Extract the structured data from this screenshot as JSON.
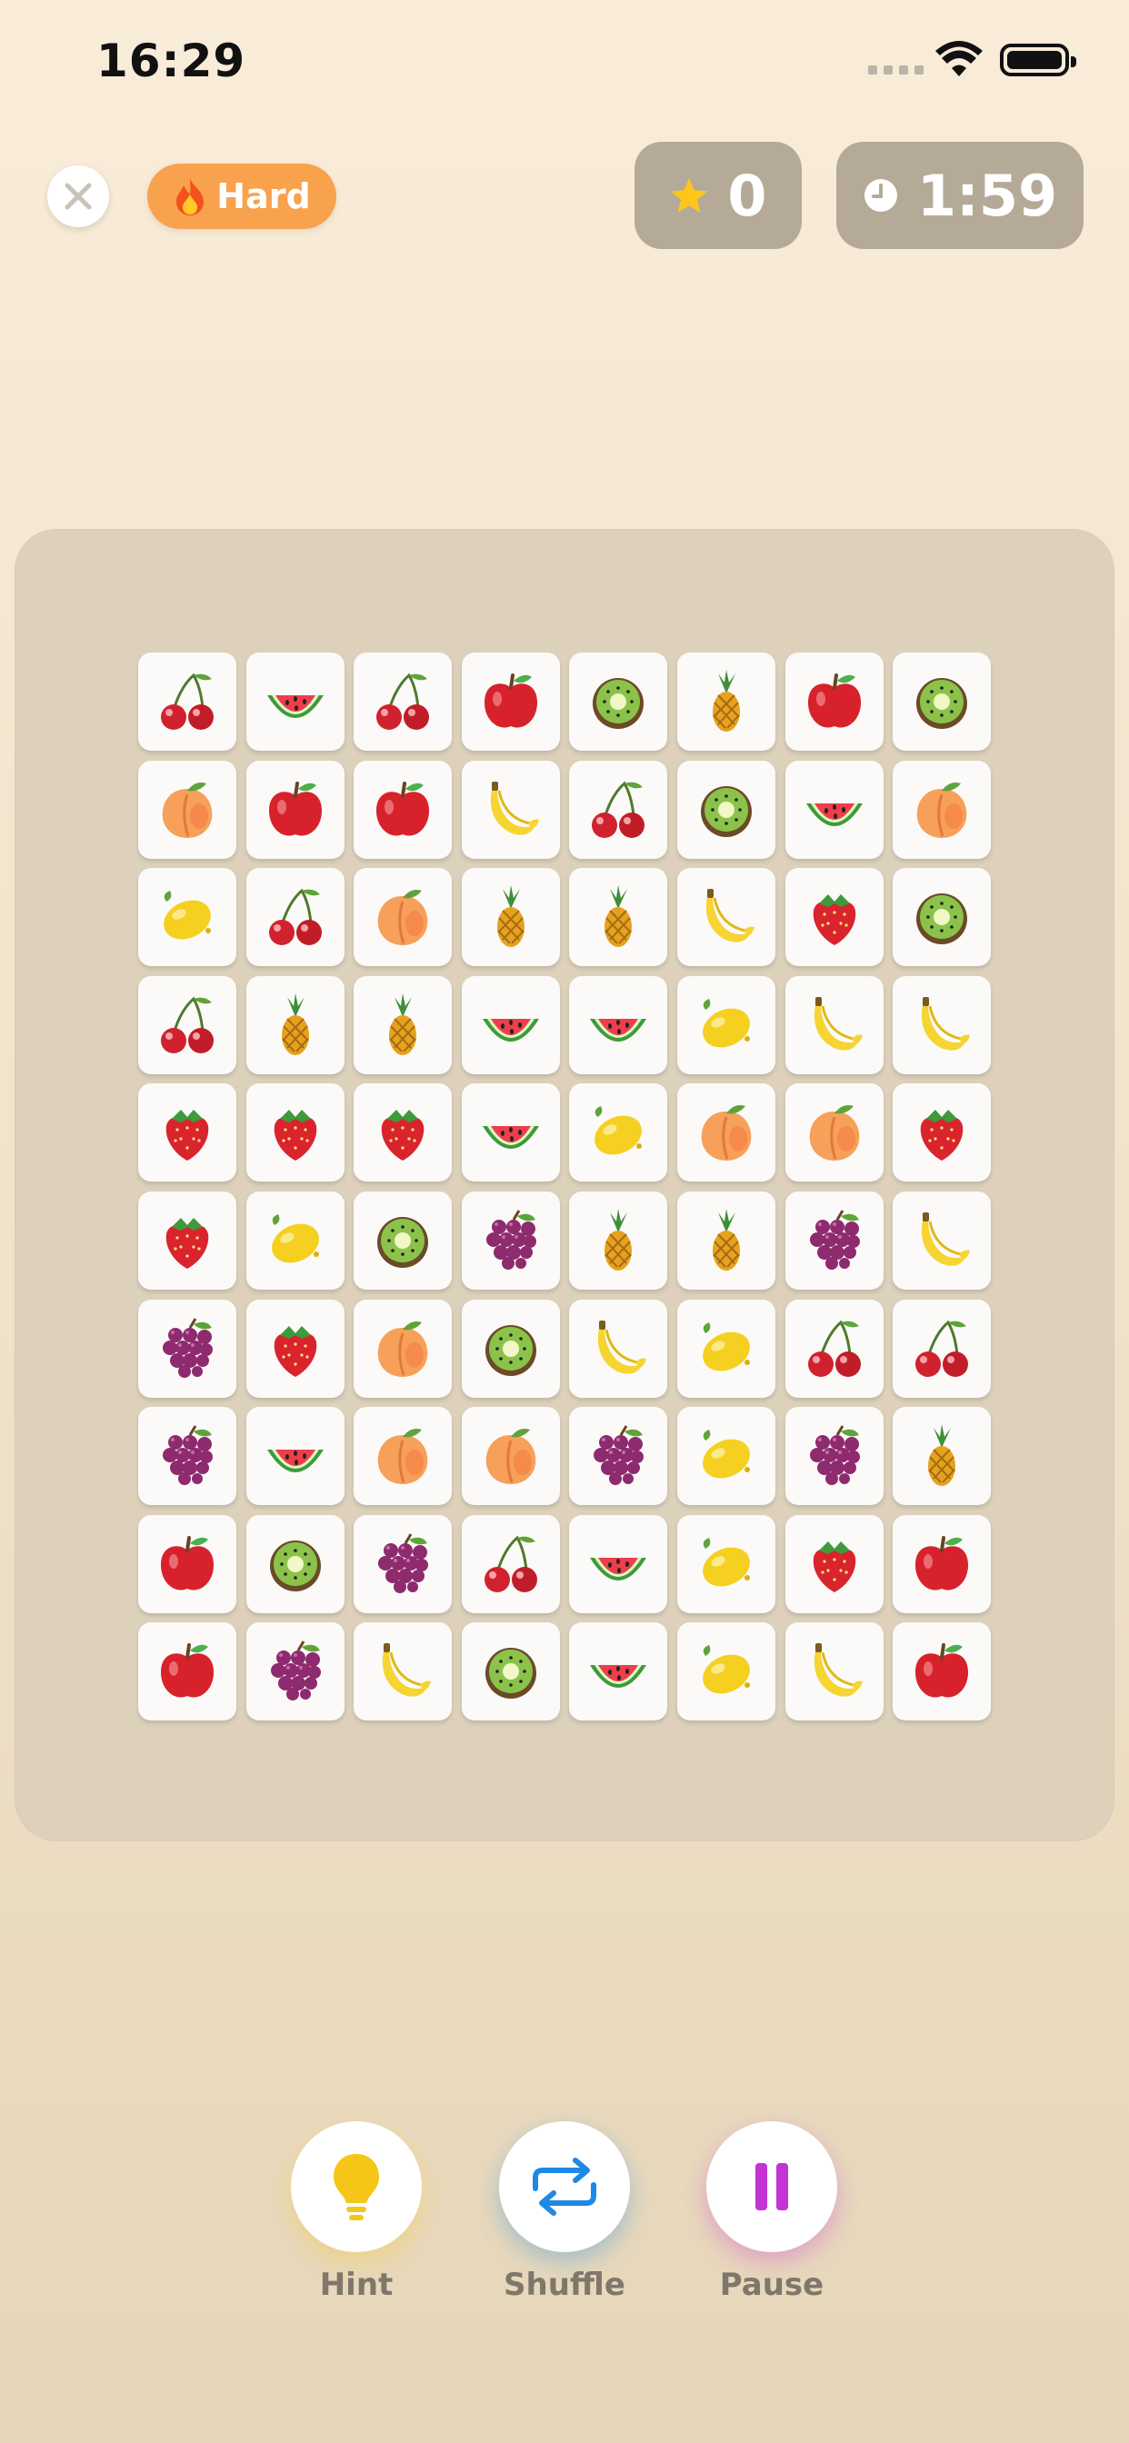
{
  "status_bar": {
    "time": "16:29"
  },
  "header": {
    "difficulty_label": "Hard",
    "difficulty_icon": "flame-icon",
    "score": "0",
    "score_icon": "star-icon",
    "timer": "1:59",
    "timer_icon": "clock-icon"
  },
  "colors": {
    "accent_orange": "#F8A24E",
    "pill_bg": "#B5AA97",
    "hint": "#F5C518",
    "shuffle": "#1E88E5",
    "pause": "#C433D6"
  },
  "board": {
    "rows": [
      [
        "cherry",
        "watermelon",
        "cherry",
        "apple",
        "kiwi",
        "pineapple",
        "apple",
        "kiwi"
      ],
      [
        "peach",
        "apple",
        "apple",
        "banana",
        "cherry",
        "kiwi",
        "watermelon",
        "peach"
      ],
      [
        "lemon",
        "cherry",
        "peach",
        "pineapple",
        "pineapple",
        "banana",
        "strawberry",
        "kiwi"
      ],
      [
        "cherry",
        "pineapple",
        "pineapple",
        "watermelon",
        "watermelon",
        "lemon",
        "banana",
        "banana"
      ],
      [
        "strawberry",
        "strawberry",
        "strawberry",
        "watermelon",
        "lemon",
        "peach",
        "peach",
        "strawberry"
      ],
      [
        "strawberry",
        "lemon",
        "kiwi",
        "grapes",
        "pineapple",
        "pineapple",
        "grapes",
        "banana"
      ],
      [
        "grapes",
        "strawberry",
        "peach",
        "kiwi",
        "banana",
        "lemon",
        "cherry",
        "cherry"
      ],
      [
        "grapes",
        "watermelon",
        "peach",
        "peach",
        "grapes",
        "lemon",
        "grapes",
        "pineapple"
      ],
      [
        "apple",
        "kiwi",
        "grapes",
        "cherry",
        "watermelon",
        "lemon",
        "strawberry",
        "apple"
      ],
      [
        "apple",
        "grapes",
        "banana",
        "kiwi",
        "watermelon",
        "lemon",
        "banana",
        "apple"
      ]
    ]
  },
  "controls": {
    "hint_label": "Hint",
    "shuffle_label": "Shuffle",
    "pause_label": "Pause"
  }
}
